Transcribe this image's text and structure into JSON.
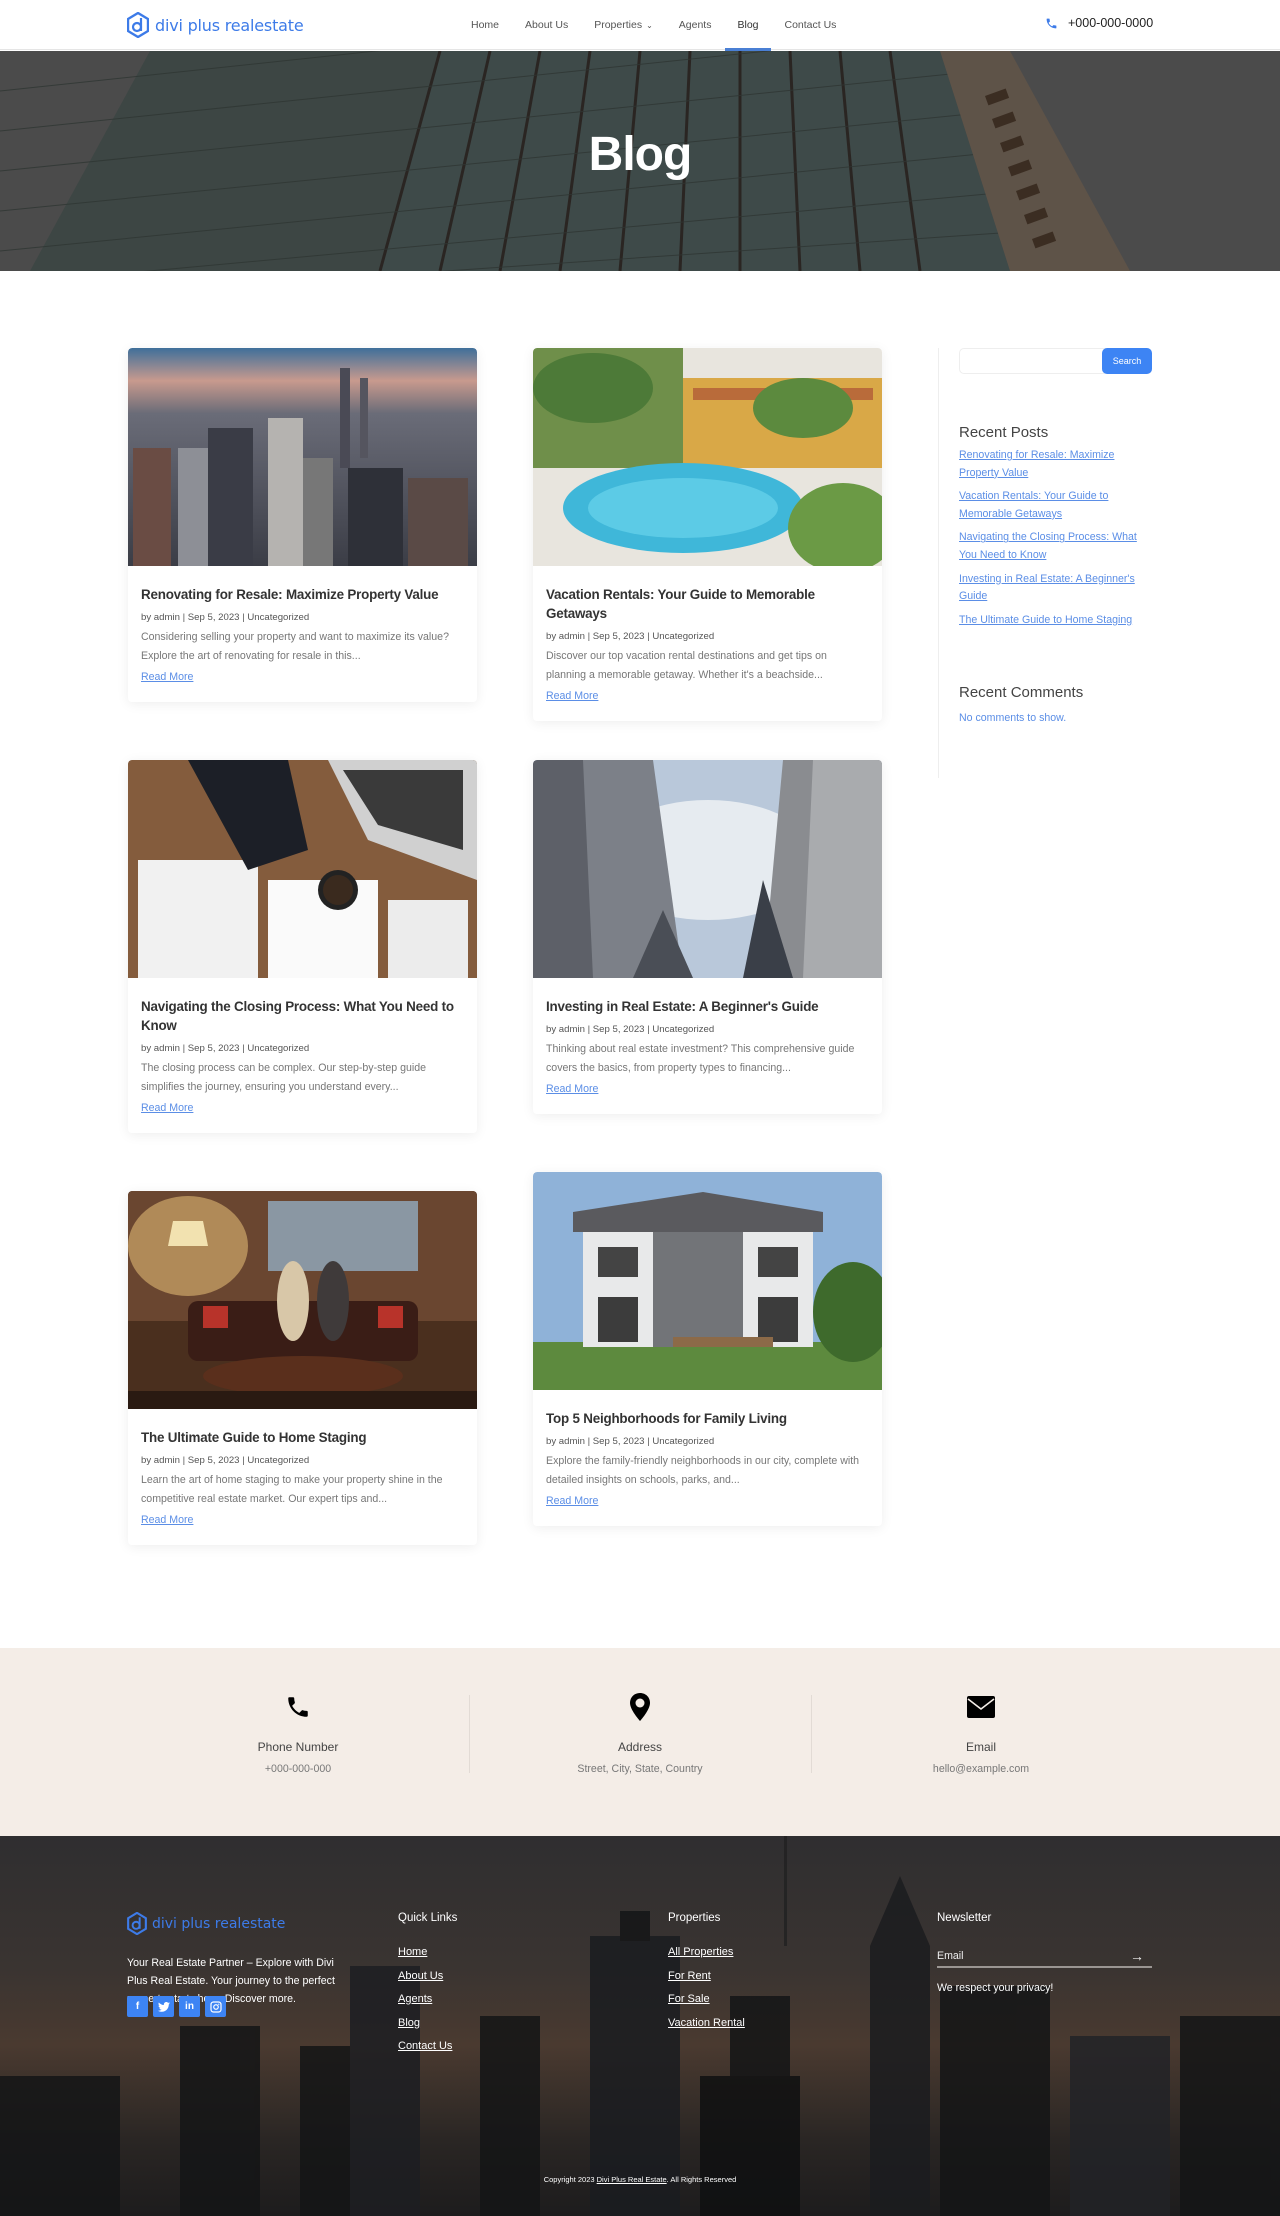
{
  "header": {
    "logo_text": "divi plus realestate",
    "nav": [
      {
        "label": "Home",
        "active": false
      },
      {
        "label": "About Us",
        "active": false
      },
      {
        "label": "Properties",
        "active": false,
        "has_dropdown": true
      },
      {
        "label": "Agents",
        "active": false
      },
      {
        "label": "Blog",
        "active": true
      },
      {
        "label": "Contact Us",
        "active": false
      }
    ],
    "phone": "+000-000-0000"
  },
  "hero": {
    "title": "Blog"
  },
  "posts": [
    {
      "title": "Renovating for Resale: Maximize Property Value",
      "author": "admin",
      "date": "Sep 5, 2023",
      "category": "Uncategorized",
      "meta": "by admin | Sep 5, 2023 | Uncategorized",
      "excerpt": "Considering selling your property and want to maximize its value? Explore the art of renovating for resale in this...",
      "read_more": "Read More",
      "image": "city-skyline-image"
    },
    {
      "title": "Vacation Rentals: Your Guide to Memorable Getaways",
      "author": "admin",
      "date": "Sep 5, 2023",
      "category": "Uncategorized",
      "meta": "by admin | Sep 5, 2023 | Uncategorized",
      "excerpt": "Discover our top vacation rental destinations and get tips on planning a memorable getaway. Whether it's a beachside...",
      "read_more": "Read More",
      "image": "resort-pool-image"
    },
    {
      "title": "Navigating the Closing Process: What You Need to Know",
      "author": "admin",
      "date": "Sep 5, 2023",
      "category": "Uncategorized",
      "meta": "by admin | Sep 5, 2023 | Uncategorized",
      "excerpt": "The closing process can be complex. Our step-by-step guide simplifies the journey, ensuring you understand every...",
      "read_more": "Read More",
      "image": "desk-documents-image"
    },
    {
      "title": "Investing in Real Estate: A Beginner's Guide",
      "author": "admin",
      "date": "Sep 5, 2023",
      "category": "Uncategorized",
      "meta": "by admin | Sep 5, 2023 | Uncategorized",
      "excerpt": "Thinking about real estate investment? This comprehensive guide covers the basics, from property types to financing...",
      "read_more": "Read More",
      "image": "skyscrapers-upward-image"
    },
    {
      "title": "The Ultimate Guide to Home Staging",
      "author": "admin",
      "date": "Sep 5, 2023",
      "category": "Uncategorized",
      "meta": "by admin | Sep 5, 2023 | Uncategorized",
      "excerpt": "Learn the art of home staging to make your property shine in the competitive real estate market. Our expert tips and...",
      "read_more": "Read More",
      "image": "living-room-couple-image"
    },
    {
      "title": "Top 5 Neighborhoods for Family Living",
      "author": "admin",
      "date": "Sep 5, 2023",
      "category": "Uncategorized",
      "meta": "by admin | Sep 5, 2023 | Uncategorized",
      "excerpt": "Explore the family-friendly neighborhoods in our city, complete with detailed insights on schools, parks, and...",
      "read_more": "Read More",
      "image": "modern-house-image"
    }
  ],
  "sidebar": {
    "search_value": "",
    "search_button": "Search",
    "recent_posts_title": "Recent Posts",
    "recent_posts": [
      "Renovating for Resale: Maximize Property Value",
      "Vacation Rentals: Your Guide to Memorable Getaways",
      "Navigating the Closing Process: What You Need to Know",
      "Investing in Real Estate: A Beginner's Guide",
      "The Ultimate Guide to Home Staging"
    ],
    "recent_comments_title": "Recent Comments",
    "no_comments": "No comments to show."
  },
  "contact": [
    {
      "icon": "phone-icon",
      "label": "Phone Number",
      "value": "+000-000-000"
    },
    {
      "icon": "map-pin-icon",
      "label": "Address",
      "value": "Street, City, State, Country"
    },
    {
      "icon": "envelope-icon",
      "label": "Email",
      "value": "hello@example.com"
    }
  ],
  "footer": {
    "logo_text": "divi plus realestate",
    "about": "Your Real Estate Partner – Explore with Divi Plus Real Estate. Your journey to the perfect property starts here. Discover more.",
    "socials": [
      {
        "icon": "facebook-icon",
        "glyph": "f"
      },
      {
        "icon": "twitter-icon",
        "glyph": "t"
      },
      {
        "icon": "linkedin-icon",
        "glyph": "in"
      },
      {
        "icon": "instagram-icon",
        "glyph": "◎"
      }
    ],
    "quick_links_title": "Quick Links",
    "quick_links": [
      "Home",
      "About Us",
      "Agents",
      "Blog",
      "Contact Us"
    ],
    "properties_title": "Properties",
    "properties_links": [
      "All Properties",
      "For Rent",
      "For Sale",
      "Vacation Rental"
    ],
    "newsletter_title": "Newsletter",
    "newsletter_placeholder": "Email",
    "newsletter_submit": "→",
    "newsletter_note": "We respect your privacy!",
    "copyright_prefix": "Copyright 2023 ",
    "copyright_link": "Divi Plus Real Estate",
    "copyright_suffix": ". All Rights Reserved"
  },
  "colors": {
    "accent": "#3d84f4",
    "link": "#5b8ee6",
    "contact_bg": "#f4ede7"
  }
}
